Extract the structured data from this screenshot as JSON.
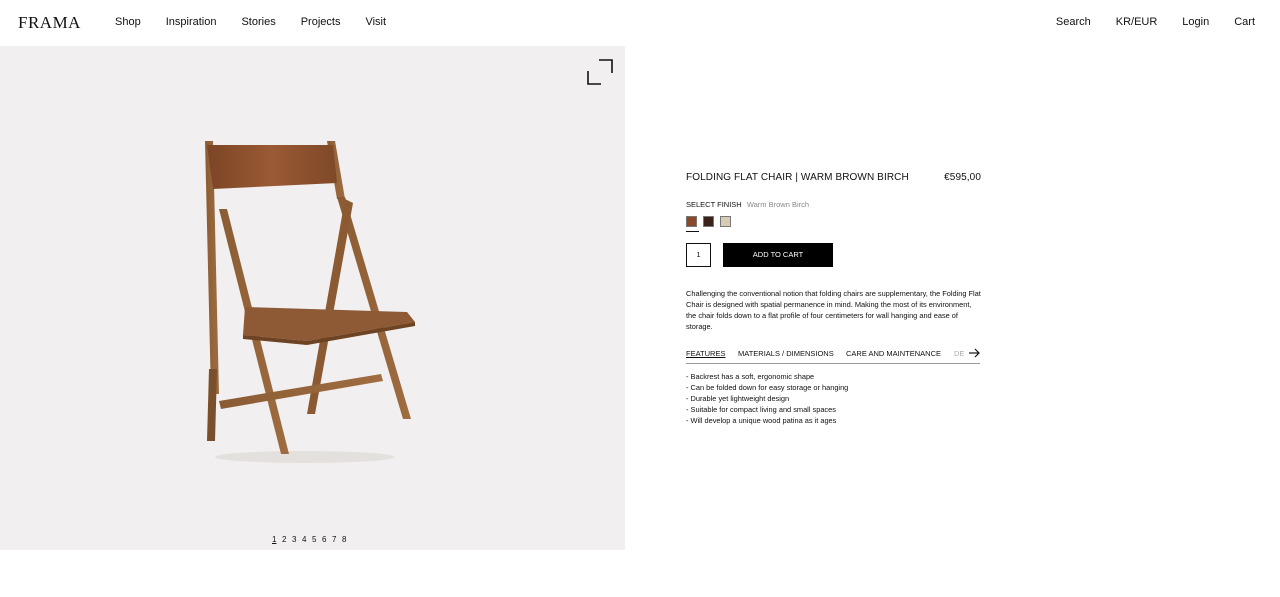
{
  "header": {
    "logo": "FRAMA",
    "nav": [
      "Shop",
      "Inspiration",
      "Stories",
      "Projects",
      "Visit"
    ],
    "right_nav": [
      "Search",
      "KR/EUR",
      "Login",
      "Cart"
    ]
  },
  "gallery": {
    "pages": [
      "1",
      "2",
      "3",
      "4",
      "5",
      "6",
      "7",
      "8"
    ],
    "active_page": "1"
  },
  "product": {
    "title": "FOLDING FLAT CHAIR | WARM BROWN BIRCH",
    "price": "€595,00",
    "finish_label": "SELECT FINISH",
    "finish_value": "Warm Brown Birch",
    "swatches": [
      "#8a4a2a",
      "#3a211a",
      "#d8cbb4"
    ],
    "quantity": "1",
    "add_to_cart": "ADD TO CART",
    "description": "Challenging the conventional notion that folding chairs are supplementary, the Folding Flat Chair is designed with spatial permanence in mind. Making the most of its environment, the chair folds down to a flat profile of four centimeters for wall hanging and ease of storage.",
    "tabs": [
      "FEATURES",
      "MATERIALS / DIMENSIONS",
      "CARE AND MAINTENANCE",
      "DE"
    ],
    "features": [
      "- Backrest has a soft, ergonomic shape",
      "- Can be folded down for easy storage or hanging",
      "- Durable yet lightweight design",
      "- Suitable for compact living and small spaces",
      "- Will develop a unique wood patina as it ages"
    ]
  }
}
